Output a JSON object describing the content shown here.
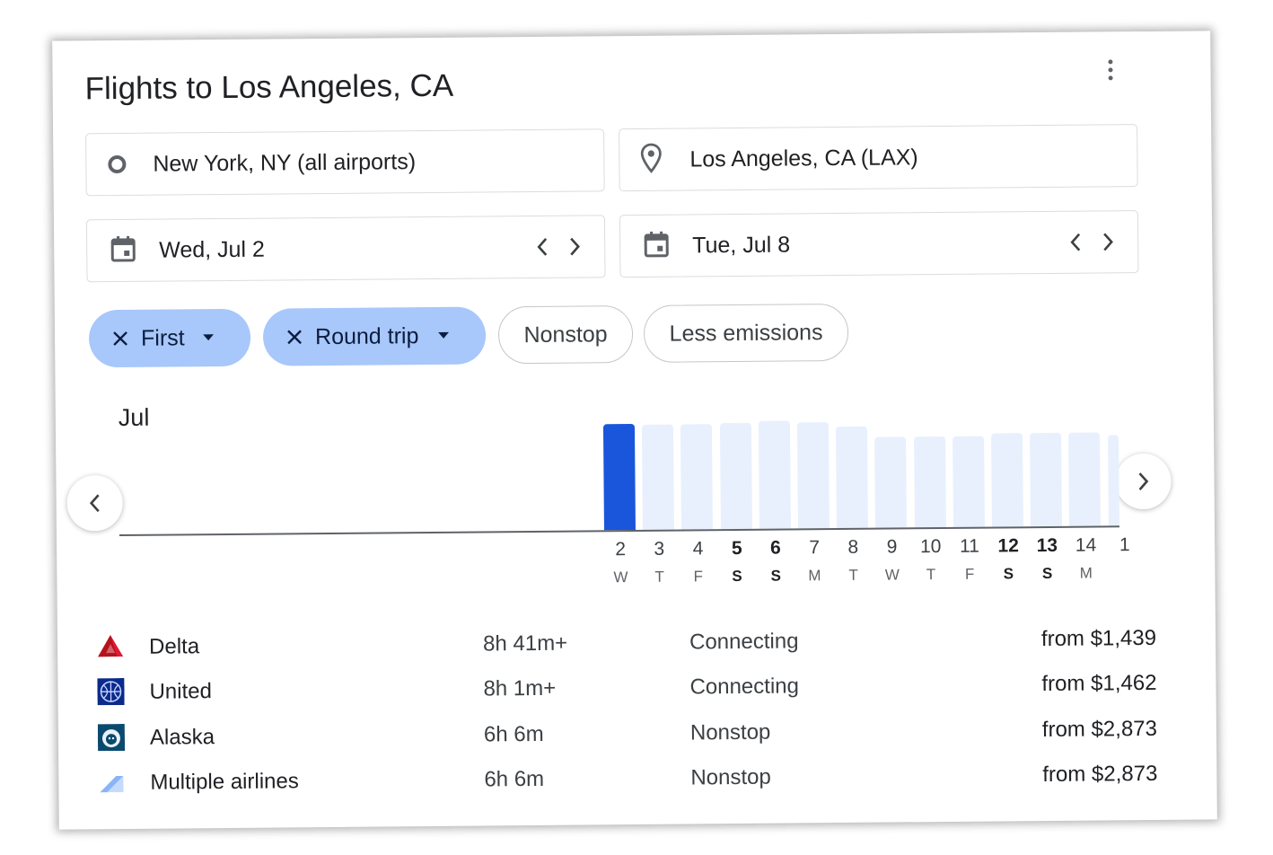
{
  "card": {
    "title": "Flights to Los Angeles, CA"
  },
  "search": {
    "origin": "New York, NY (all airports)",
    "destination": "Los Angeles, CA (LAX)",
    "departure_date": "Wed, Jul 2",
    "return_date": "Tue, Jul 8"
  },
  "filters": {
    "cabin": "First",
    "trip_type": "Round trip",
    "nonstop": "Nonstop",
    "emissions": "Less emissions"
  },
  "calendar": {
    "month": "Jul",
    "selected_day": "2",
    "days": [
      {
        "num": "2",
        "dow": "W",
        "weekend": false
      },
      {
        "num": "3",
        "dow": "T",
        "weekend": false
      },
      {
        "num": "4",
        "dow": "F",
        "weekend": false
      },
      {
        "num": "5",
        "dow": "S",
        "weekend": true
      },
      {
        "num": "6",
        "dow": "S",
        "weekend": true
      },
      {
        "num": "7",
        "dow": "M",
        "weekend": false
      },
      {
        "num": "8",
        "dow": "T",
        "weekend": false
      },
      {
        "num": "9",
        "dow": "W",
        "weekend": false
      },
      {
        "num": "10",
        "dow": "T",
        "weekend": false
      },
      {
        "num": "11",
        "dow": "F",
        "weekend": false
      },
      {
        "num": "12",
        "dow": "S",
        "weekend": true
      },
      {
        "num": "13",
        "dow": "S",
        "weekend": true
      },
      {
        "num": "14",
        "dow": "M",
        "weekend": false
      },
      {
        "num": "1",
        "dow": "",
        "weekend": false
      }
    ],
    "relative_prices": [
      1.0,
      0.99,
      0.99,
      1.0,
      1.02,
      1.0,
      0.96,
      0.86,
      0.86,
      0.86,
      0.88,
      0.88,
      0.88,
      0.86
    ]
  },
  "results": [
    {
      "airline": "Delta",
      "duration": "8h 41m+",
      "stops": "Connecting",
      "price": "from $1,439",
      "logo": "delta-logo-icon"
    },
    {
      "airline": "United",
      "duration": "8h 1m+",
      "stops": "Connecting",
      "price": "from $1,462",
      "logo": "united-logo-icon"
    },
    {
      "airline": "Alaska",
      "duration": "6h 6m",
      "stops": "Nonstop",
      "price": "from $2,873",
      "logo": "alaska-logo-icon"
    },
    {
      "airline": "Multiple airlines",
      "duration": "6h 6m",
      "stops": "Nonstop",
      "price": "from $2,873",
      "logo": "multiple-airlines-icon"
    }
  ],
  "colors": {
    "selected_bar": "#1a56db",
    "bar": "#e8f0fe",
    "active_chip": "#a8c7fa"
  }
}
